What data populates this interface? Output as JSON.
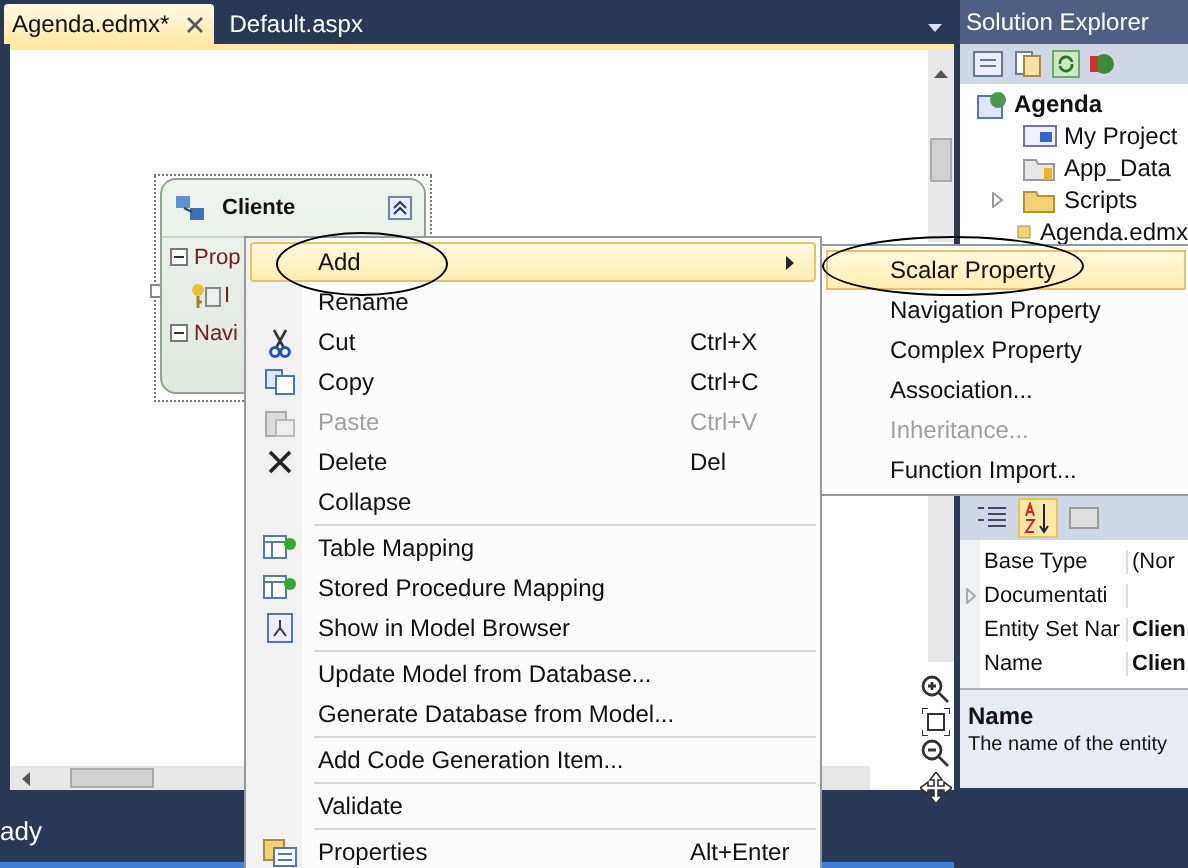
{
  "tabs": [
    {
      "label": "Agenda.edmx*",
      "selected": true,
      "closable": true
    },
    {
      "label": "Default.aspx",
      "selected": false,
      "closable": false
    }
  ],
  "entity": {
    "title": "Cliente",
    "sections": [
      {
        "label": "Prop",
        "expanded": true,
        "members": [
          "I"
        ]
      },
      {
        "label": "Navi",
        "expanded": true
      }
    ]
  },
  "status_bar": {
    "text": "ady"
  },
  "solution_explorer": {
    "title": "Solution Explorer",
    "tree": [
      {
        "label": "Agenda",
        "children": [
          {
            "label": "My Project",
            "kind": "myproject",
            "collapsed": false
          },
          {
            "label": "App_Data",
            "kind": "datafolder",
            "collapsed": false
          },
          {
            "label": "Scripts",
            "kind": "folder",
            "collapsed": true
          },
          {
            "label": "Agenda.edmx",
            "kind": "edmx",
            "collapsed": false
          }
        ]
      }
    ]
  },
  "properties_panel": {
    "toolbar": [
      {
        "selected": false
      },
      {
        "selected": true
      },
      {
        "selected": false
      }
    ],
    "rows": [
      {
        "name": "Base Type",
        "value": "(Nor",
        "modified": false,
        "collapsed": false
      },
      {
        "name": "Documentati",
        "collapsed": true
      },
      {
        "name": "Entity Set Nar",
        "value": "Clien",
        "modified": true,
        "collapsed": false
      },
      {
        "name": "Name",
        "value": "Clien",
        "modified": true,
        "collapsed": false
      }
    ],
    "description": {
      "title": "Name",
      "text": "The name of the entity"
    }
  },
  "context_menu": [
    {
      "kind": "item",
      "label": "Add",
      "selected": true,
      "disabled": false,
      "submenu": true
    },
    {
      "kind": "item",
      "label": "Rename",
      "selected": false,
      "disabled": false,
      "submenu": false
    },
    {
      "kind": "item",
      "label": "Cut",
      "shortcut": "Ctrl+X",
      "selected": false,
      "disabled": false,
      "submenu": false
    },
    {
      "kind": "item",
      "label": "Copy",
      "shortcut": "Ctrl+C",
      "selected": false,
      "disabled": false,
      "submenu": false
    },
    {
      "kind": "item",
      "label": "Paste",
      "shortcut": "Ctrl+V",
      "selected": false,
      "disabled": true,
      "submenu": false
    },
    {
      "kind": "item",
      "label": "Delete",
      "shortcut": "Del",
      "selected": false,
      "disabled": false,
      "submenu": false
    },
    {
      "kind": "item",
      "label": "Collapse",
      "selected": false,
      "disabled": false,
      "submenu": false
    },
    {
      "kind": "separator"
    },
    {
      "kind": "item",
      "label": "Table Mapping",
      "selected": false,
      "disabled": false,
      "submenu": false
    },
    {
      "kind": "item",
      "label": "Stored Procedure Mapping",
      "selected": false,
      "disabled": false,
      "submenu": false
    },
    {
      "kind": "item",
      "label": "Show in Model Browser",
      "selected": false,
      "disabled": false,
      "submenu": false
    },
    {
      "kind": "separator"
    },
    {
      "kind": "item",
      "label": "Update Model from Database...",
      "selected": false,
      "disabled": false,
      "submenu": false
    },
    {
      "kind": "item",
      "label": "Generate Database from Model...",
      "selected": false,
      "disabled": false,
      "submenu": false
    },
    {
      "kind": "separator"
    },
    {
      "kind": "item",
      "label": "Add Code Generation Item...",
      "selected": false,
      "disabled": false,
      "submenu": false
    },
    {
      "kind": "separator"
    },
    {
      "kind": "item",
      "label": "Validate",
      "selected": false,
      "disabled": false,
      "submenu": false
    },
    {
      "kind": "separator"
    },
    {
      "kind": "item",
      "label": "Properties",
      "shortcut": "Alt+Enter",
      "selected": false,
      "disabled": false,
      "submenu": false
    }
  ],
  "submenu": [
    {
      "label": "Scalar Property",
      "selected": true,
      "disabled": false
    },
    {
      "label": "Navigation Property",
      "selected": false,
      "disabled": false
    },
    {
      "label": "Complex Property",
      "selected": false,
      "disabled": false
    },
    {
      "label": "Association...",
      "selected": false,
      "disabled": false
    },
    {
      "label": "Inheritance...",
      "selected": false,
      "disabled": true
    },
    {
      "label": "Function Import...",
      "selected": false,
      "disabled": false
    }
  ]
}
